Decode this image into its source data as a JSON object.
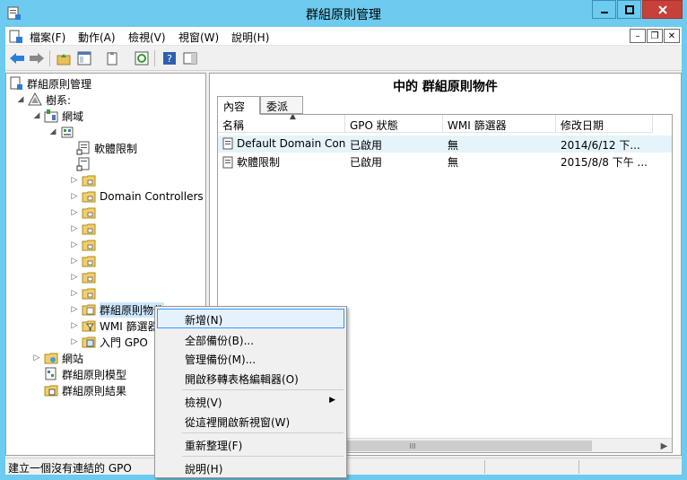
{
  "window": {
    "title": "群組原則管理"
  },
  "menubar": [
    "檔案(F)",
    "動作(A)",
    "檢視(V)",
    "視窗(W)",
    "說明(H)"
  ],
  "tree": {
    "root": "群組原則管理",
    "forest": "樹系:",
    "domains": "網域",
    "domain": "",
    "gpo_software_restriction": "軟體限制",
    "gpo_unnamed": "",
    "ou_1": "",
    "ou_domain_controllers": "Domain Controllers",
    "ou_3": "",
    "ou_4": "",
    "ou_5": "",
    "ou_6": "",
    "ou_7": "",
    "ou_8": "",
    "group_policy_objects": "群組原則物件",
    "wmi_filters": "WMI 篩選器",
    "starter_gpos": "入門 GPO",
    "sites": "網站",
    "gp_modeling": "群組原則模型",
    "gp_results": "群組原則結果"
  },
  "right": {
    "header": "中的 群組原則物件",
    "tabs": [
      "內容",
      "委派"
    ],
    "columns": [
      "名稱",
      "GPO 狀態",
      "WMI 篩選器",
      "修改日期"
    ],
    "rows": [
      {
        "name": "Default Domain Con...",
        "status": "已啟用",
        "wmi": "無",
        "modified": "2014/6/12 下..."
      },
      {
        "name": "軟體限制",
        "status": "已啟用",
        "wmi": "無",
        "modified": "2015/8/8 下午 ..."
      }
    ],
    "scroll_thumb": "III"
  },
  "context_menu": {
    "items": [
      "新增(N)",
      "全部備份(B)...",
      "管理備份(M)...",
      "開啟移轉表格編輯器(O)",
      "檢視(V)",
      "從這裡開啟新視窗(W)",
      "重新整理(F)",
      "說明(H)"
    ]
  },
  "status": {
    "text": "建立一個沒有連結的 GPO"
  }
}
